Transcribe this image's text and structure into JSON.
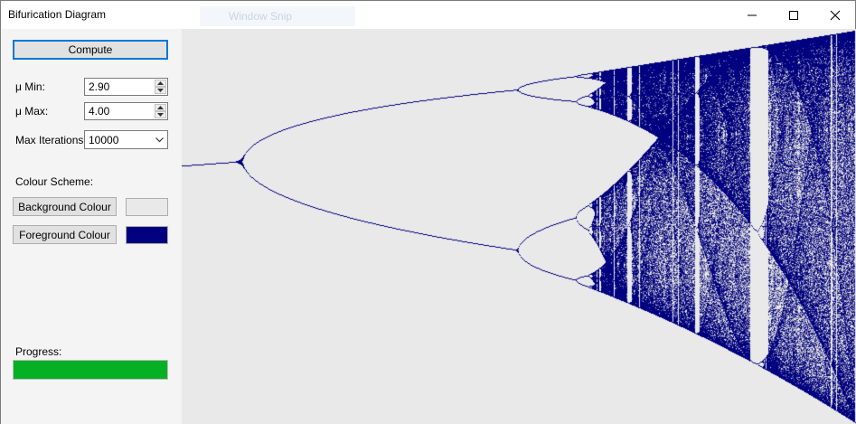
{
  "window": {
    "title": "Bifurication Diagram",
    "ghost_window_label": "Window Snip"
  },
  "controls": {
    "compute_label": "Compute",
    "mu_min_label": "μ Min:",
    "mu_min_value": "2.90",
    "mu_max_label": "μ Max:",
    "mu_max_value": "4.00",
    "max_iter_label": "Max Iterations:",
    "max_iter_value": "10000",
    "colour_scheme_label": "Colour Scheme:",
    "background_button": "Background Colour",
    "foreground_button": "Foreground Colour",
    "background_colour": "#e9e9e9",
    "foreground_colour": "#000080",
    "progress_label": "Progress:",
    "progress_value": 1.0,
    "progress_colour": "#06b025"
  },
  "icons": [
    "minimize-icon",
    "maximize-icon",
    "close-icon",
    "spin-up-icon",
    "spin-down-icon",
    "chevron-down-icon"
  ]
}
